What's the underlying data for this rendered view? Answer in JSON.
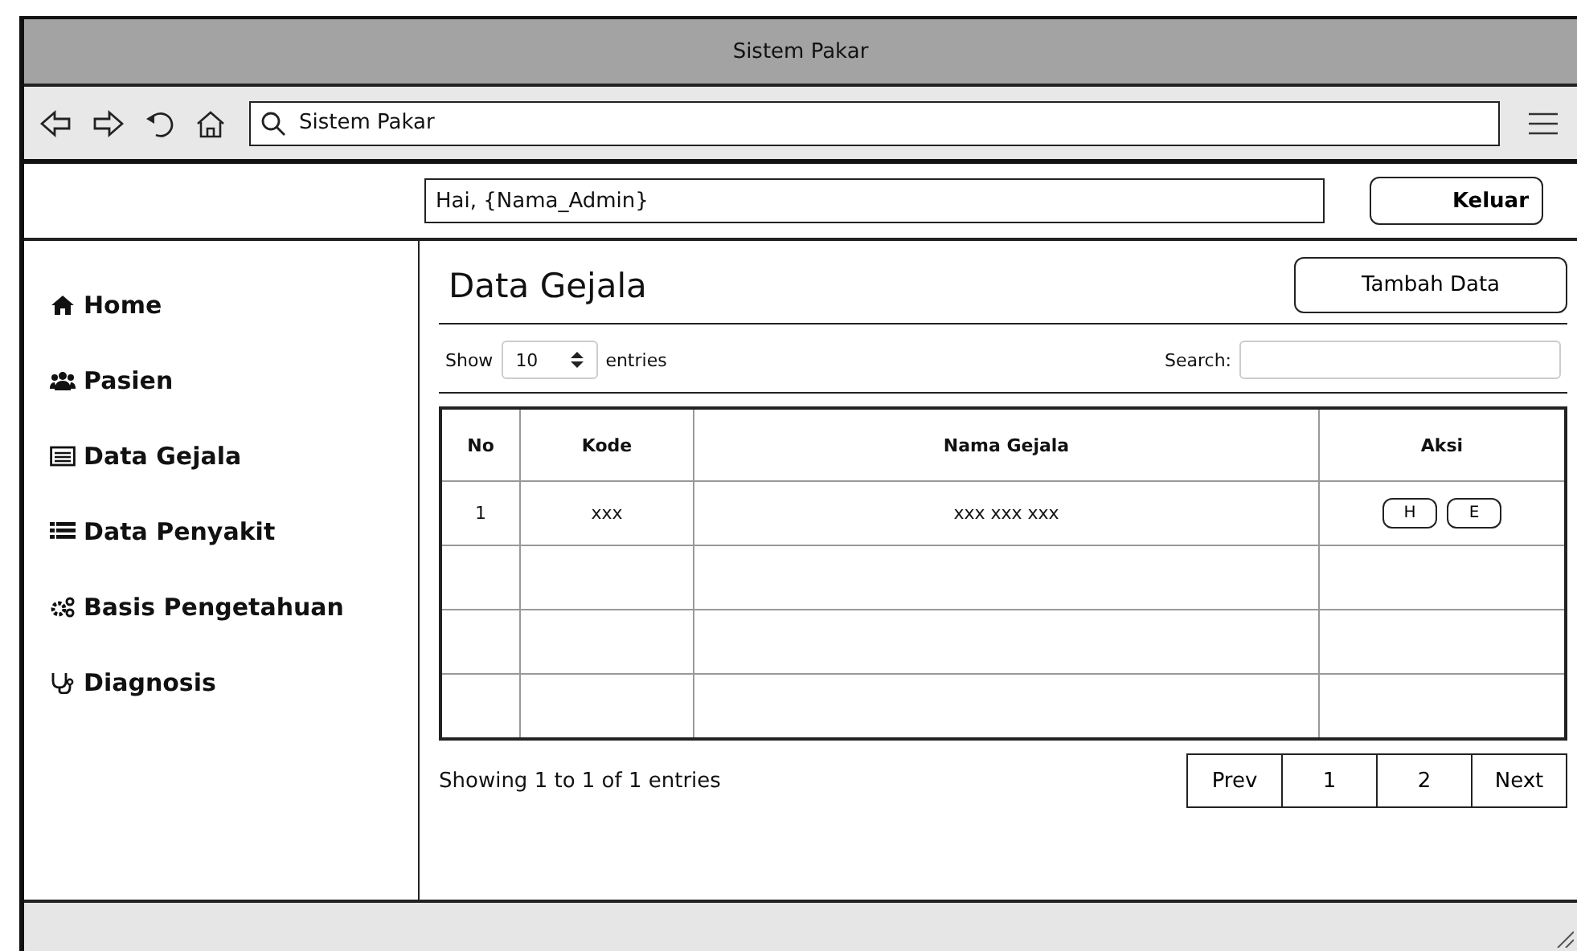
{
  "window": {
    "title": "Sistem Pakar"
  },
  "browser": {
    "address": "Sistem Pakar"
  },
  "header": {
    "greeting": "Hai, {Nama_Admin}",
    "logout": "Keluar"
  },
  "sidebar": {
    "items": [
      {
        "label": "Home"
      },
      {
        "label": "Pasien"
      },
      {
        "label": "Data Gejala"
      },
      {
        "label": "Data Penyakit"
      },
      {
        "label": "Basis Pengetahuan"
      },
      {
        "label": "Diagnosis"
      }
    ]
  },
  "main": {
    "title": "Data Gejala",
    "add_button": "Tambah Data",
    "show_label": "Show",
    "entries_value": "10",
    "entries_label": "entries",
    "search_label": "Search:"
  },
  "table": {
    "columns": [
      "No",
      "Kode",
      "Nama Gejala",
      "Aksi"
    ],
    "rows": [
      {
        "no": "1",
        "kode": "xxx",
        "nama": "xxx xxx xxx",
        "actions": [
          "H",
          "E"
        ]
      },
      {},
      {},
      {}
    ]
  },
  "info": "Showing 1 to 1 of 1 entries",
  "pagination": [
    "Prev",
    "1",
    "2",
    "Next"
  ]
}
